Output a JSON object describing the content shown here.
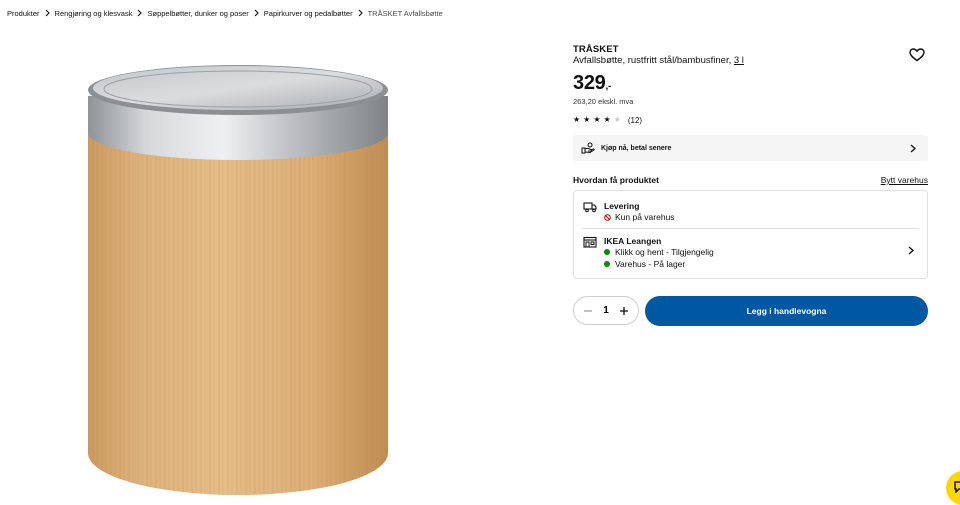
{
  "breadcrumb": {
    "items": [
      {
        "label": "Produkter"
      },
      {
        "label": "Rengjøring og klesvask"
      },
      {
        "label": "Søppelbøtter, dunker og poser"
      },
      {
        "label": "Papirkurver og pedalbøtter"
      }
    ],
    "current": "TRÅSKET Avfallsbøtte"
  },
  "product": {
    "name": "TRÅSKET",
    "description": "Avfallsbøtte, rustfritt stål/bambusfiner, ",
    "size_link": "3 l",
    "price": "329",
    "price_suffix": ",-",
    "price_ex_vat": "263,20 ekskl. mva",
    "rating_value": 3.5,
    "rating_count": "(12)"
  },
  "bnpl": {
    "label": "Kjøp nå, betal senere",
    "icon": "hand-money-icon"
  },
  "fulfilment": {
    "title": "Hvordan få produktet",
    "change_store": "Bytt varehus",
    "delivery": {
      "title": "Levering",
      "status": "Kun på varehus",
      "icon": "truck-icon",
      "status_icon": "not-available-icon",
      "status_color": "#cc0008"
    },
    "store": {
      "name": "IKEA Leangen",
      "click_collect": "Klikk og hent - Tilgjengelig",
      "in_store": "Varehus - På lager",
      "icon": "store-icon",
      "ok_color": "#0a8a00"
    }
  },
  "quantity": {
    "value": "1"
  },
  "cart": {
    "label": "Legg i handlevogna"
  },
  "colors": {
    "primary": "#0058a3",
    "chat": "#ffd700",
    "available": "#0a8a00"
  }
}
